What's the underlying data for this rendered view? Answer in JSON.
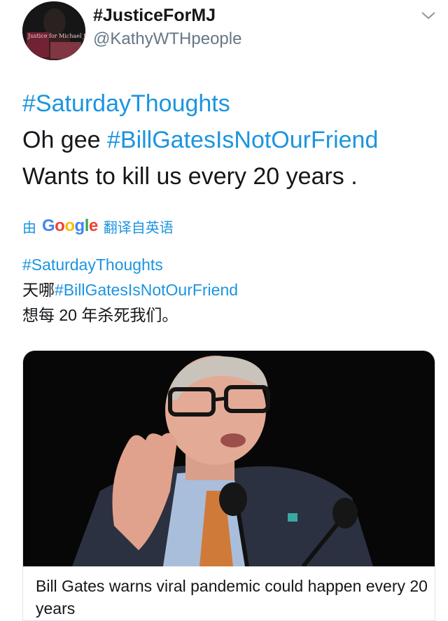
{
  "user": {
    "display_name": "#JusticeForMJ",
    "handle": "@KathyWTHpeople",
    "avatar_icon": "profile-avatar",
    "avatar_text": "Justice for Michael Jackson"
  },
  "tweet": {
    "line1_tag": "#SaturdayThoughts",
    "line2_text": "Oh gee ",
    "line2_tag": "#BillGatesIsNotOurFriend",
    "line3_text": "Wants to kill us every 20 years ."
  },
  "translate": {
    "prefix": "由",
    "brand": "Google",
    "suffix": "翻译自英语"
  },
  "translation": {
    "line1_tag": "#SaturdayThoughts",
    "line2_text": "天哪",
    "line2_tag": "#BillGatesIsNotOurFriend",
    "line3_text": "想每 20 年杀死我们。"
  },
  "card": {
    "title": "Bill Gates warns viral pandemic could happen every 20 years"
  },
  "colors": {
    "link": "#1b95e0",
    "text": "#14171a",
    "secondary": "#657786"
  }
}
